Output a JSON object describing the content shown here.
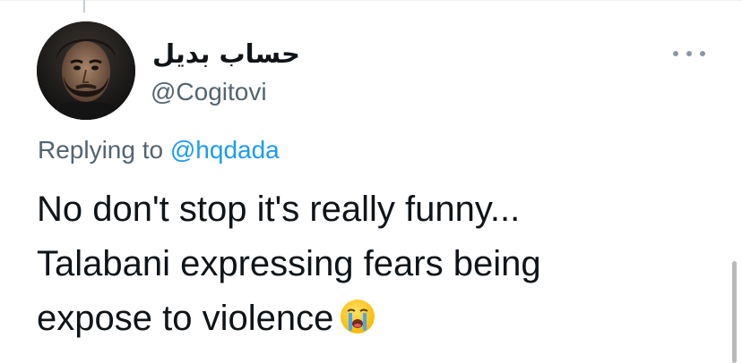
{
  "author": {
    "display_name": "حساب بديل",
    "handle": "@Cogitovi",
    "avatar_icon": "user-avatar-photo"
  },
  "reply": {
    "prefix": "Replying to",
    "mention": "@hqdada"
  },
  "tweet": {
    "lines": [
      "No don't stop it's really funny...",
      "Talabani expressing fears being",
      "expose to violence"
    ],
    "emoji": "loudly-crying-face-icon"
  },
  "colors": {
    "mention": "#1d9bf0",
    "secondary_text": "#536471",
    "primary_text": "#0f1419"
  }
}
